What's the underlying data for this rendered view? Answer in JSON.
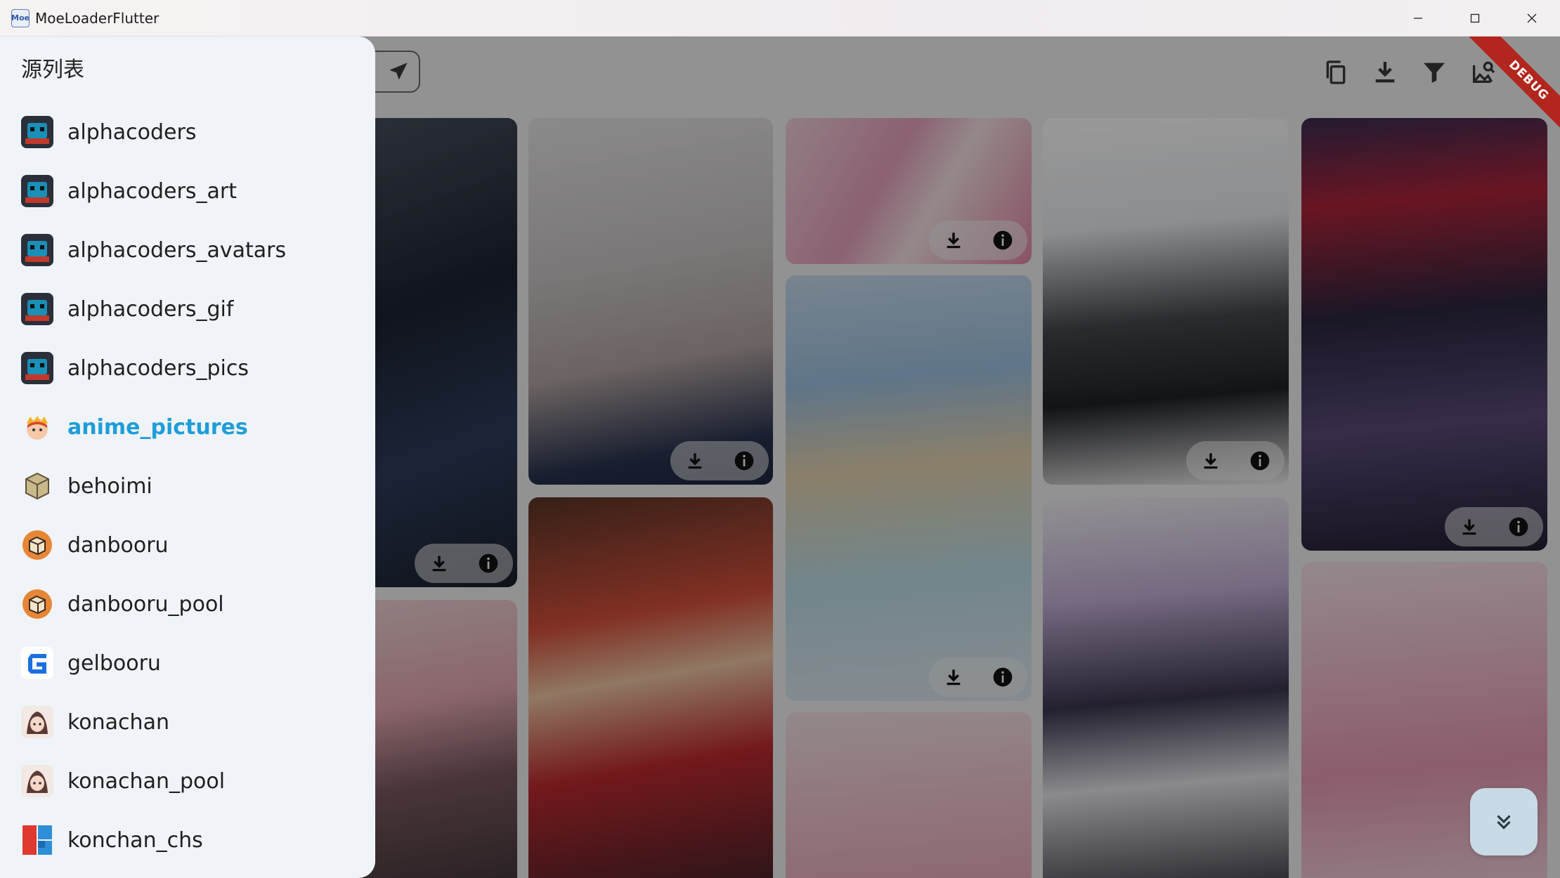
{
  "window": {
    "title": "MoeLoaderFlutter",
    "icon_text": "Moe"
  },
  "toolbar": {
    "icons": [
      "copy-icon",
      "download-icon",
      "filter-icon",
      "image-search-icon"
    ],
    "debug_banner": "DEBUG"
  },
  "drawer": {
    "title": "源列表",
    "selected_index": 5,
    "items": [
      {
        "label": "alphacoders",
        "logo": "alphacoders-logo"
      },
      {
        "label": "alphacoders_art",
        "logo": "alphacoders-logo"
      },
      {
        "label": "alphacoders_avatars",
        "logo": "alphacoders-logo"
      },
      {
        "label": "alphacoders_gif",
        "logo": "alphacoders-logo"
      },
      {
        "label": "alphacoders_pics",
        "logo": "alphacoders-logo"
      },
      {
        "label": "anime_pictures",
        "logo": "anime-pictures-logo"
      },
      {
        "label": "behoimi",
        "logo": "behoimi-logo"
      },
      {
        "label": "danbooru",
        "logo": "danbooru-logo"
      },
      {
        "label": "danbooru_pool",
        "logo": "danbooru-logo"
      },
      {
        "label": "gelbooru",
        "logo": "gelbooru-logo"
      },
      {
        "label": "konachan",
        "logo": "konachan-logo"
      },
      {
        "label": "konachan_pool",
        "logo": "konachan-logo"
      },
      {
        "label": "konchan_chs",
        "logo": "konchan-chs-logo"
      }
    ]
  },
  "colors": {
    "accent": "#1e9ed8",
    "debug": "#b3261e",
    "fab": "#c7dae6"
  }
}
